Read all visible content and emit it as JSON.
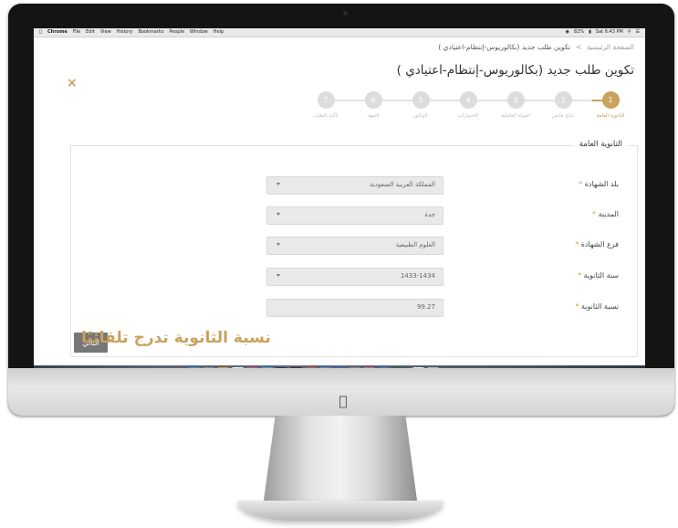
{
  "menubar": {
    "app": "Chrome",
    "items": [
      "File",
      "Edit",
      "View",
      "History",
      "Bookmarks",
      "People",
      "Window",
      "Help"
    ],
    "battery": "82%",
    "clock": "Sat 6:43 PM"
  },
  "breadcrumb": {
    "home": "الصفحة الرئيسية",
    "separator": ">",
    "current": "تكوين طلب جديد (بكالوريوس-إنتظام-اعتيادي )"
  },
  "page_title": "تكوين طلب جديد (بكالوريوس-إنتظام-اعتيادي )",
  "close_icon": "×",
  "steps": [
    {
      "num": "1",
      "label": "الثانوية العامة"
    },
    {
      "num": "2",
      "label": "نتائج قياس"
    },
    {
      "num": "3",
      "label": "المواد العاملية"
    },
    {
      "num": "4",
      "label": "الاختيارات"
    },
    {
      "num": "5",
      "label": "الوثائق"
    },
    {
      "num": "6",
      "label": "التعهد"
    },
    {
      "num": "7",
      "label": "تأكيد الطلب"
    }
  ],
  "form": {
    "legend": "الثانوية العامة",
    "fields": [
      {
        "label": "بلد الشهادة",
        "star": "*",
        "value": "المملكة العربية السعودية"
      },
      {
        "label": "المدينة",
        "star": "*",
        "value": "جدة"
      },
      {
        "label": "فرع الشهادة",
        "star": "*",
        "value": "العلوم الطبيعية"
      },
      {
        "label": "سنة الثانوية",
        "star": "*",
        "value": "1433-1434"
      },
      {
        "label": "نسبة الثانوية",
        "star": "*",
        "value": "99.27"
      }
    ],
    "next_label": "التالي"
  },
  "promo": "نسبة الثانوية تدرج تلقائيًا",
  "colors": {
    "accent": "#c9a25c",
    "bezel": "#141414",
    "field_bg": "#e9e9e9"
  },
  "dock_icons": [
    "finder-icon",
    "launchpad-icon",
    "chrome-icon",
    "notes-icon",
    "itunes-icon",
    "twitter-icon",
    "photoshop-icon",
    "illustrator-icon",
    "link-icon",
    "skype-icon",
    "s-icon",
    "camera-icon",
    "photos-icon",
    "s2-icon",
    "graph-icon",
    "doc-icon",
    "trash-icon"
  ]
}
